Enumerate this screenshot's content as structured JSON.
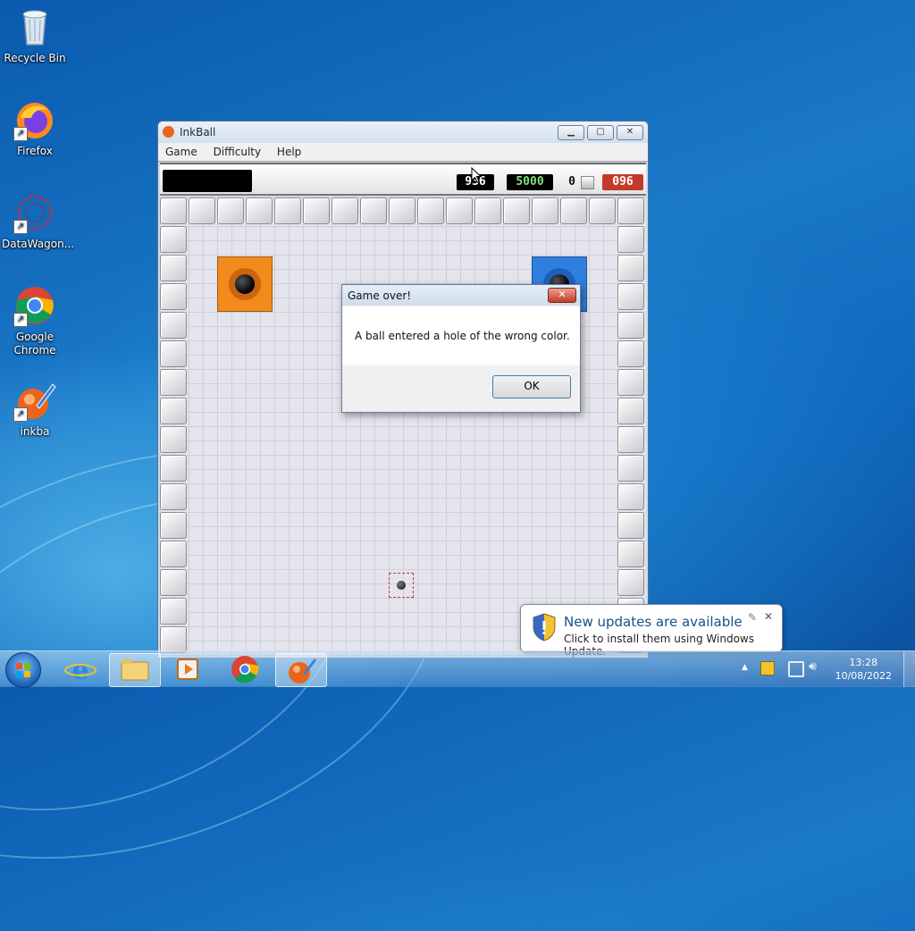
{
  "desktop": {
    "icons": [
      {
        "label": "Recycle Bin"
      },
      {
        "label": "Firefox"
      },
      {
        "label": "DataWagon..."
      },
      {
        "label": "Google Chrome"
      },
      {
        "label": "inkba"
      }
    ]
  },
  "window": {
    "title": "InkBall",
    "menu": [
      "Game",
      "Difficulty",
      "Help"
    ],
    "score": {
      "current": "936",
      "target": "5000",
      "balls_count": "0",
      "timer": "096"
    }
  },
  "dialog": {
    "title": "Game over!",
    "message": "A ball entered a hole of the wrong color.",
    "ok_label": "OK",
    "close_label": "✕"
  },
  "notification": {
    "title": "New updates are available",
    "subtitle": "Click to install them using Windows Update."
  },
  "taskbar": {
    "time": "13:28",
    "date": "10/08/2022"
  },
  "colors": {
    "hole_orange": "#f28a1c",
    "hole_blue": "#2f7fe0",
    "score_green": "#7fe07f",
    "timer_red": "#c43a2a"
  }
}
